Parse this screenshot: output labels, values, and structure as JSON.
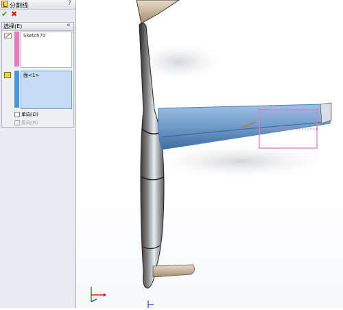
{
  "property_manager": {
    "title": "分割线",
    "help": "?",
    "ok": "✔",
    "cancel": "✖",
    "selection": {
      "title": "选择(E)",
      "collapse": "«",
      "sketch_item": "Sketch70",
      "face_item": "面<1>",
      "single_direction": "单向(D)",
      "reverse_direction": "反向(R)"
    }
  },
  "colors": {
    "sketch_list_accent": "#e77ab8",
    "face_list_accent": "#4a96d8",
    "face_list_bg": "#c6dcf4",
    "model_face": "#6f9bc9",
    "sketch_rect": "#e879b8"
  },
  "icons": {
    "ok": "check-icon",
    "cancel": "x-icon",
    "feature": "split-line-icon",
    "sketch": "sketch-icon",
    "face": "face-icon",
    "triad": "axis-triad-icon"
  }
}
